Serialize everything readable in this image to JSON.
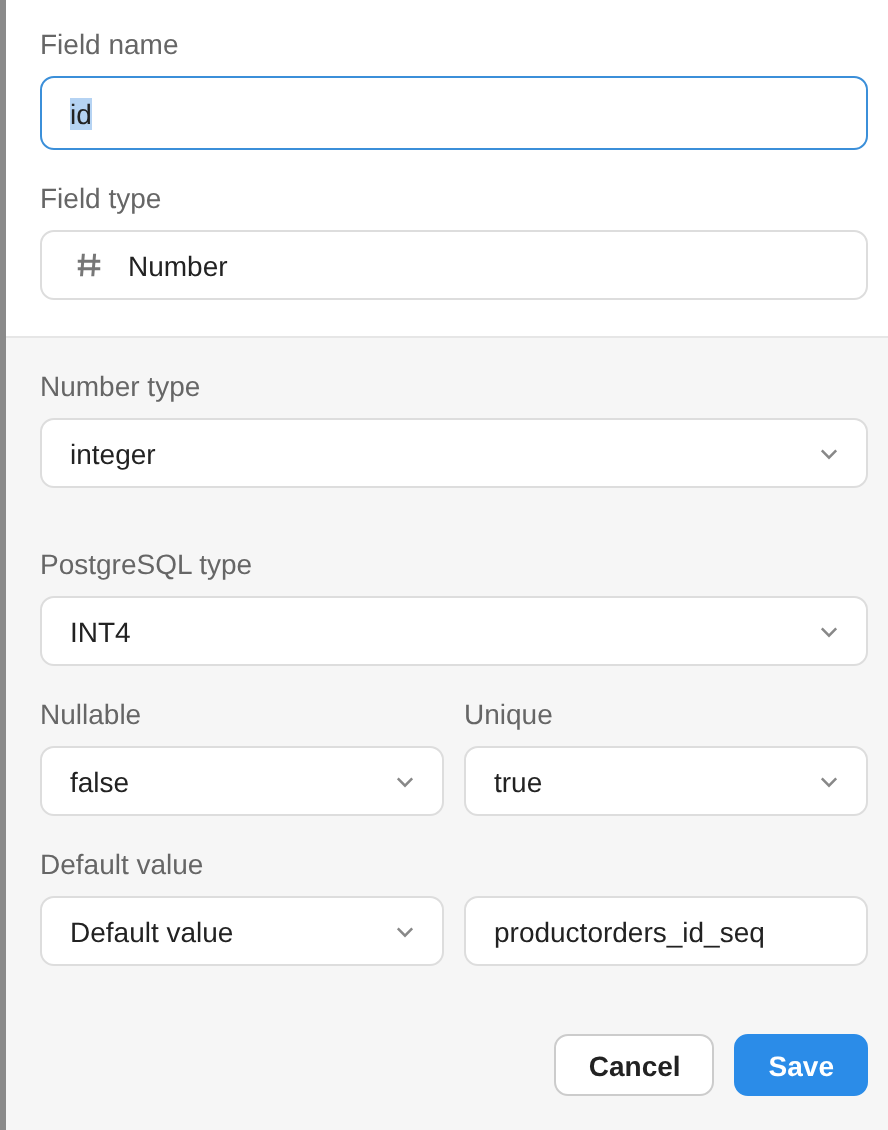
{
  "name_field": {
    "label": "Field name",
    "value": "id",
    "focused": true,
    "highlighted": true
  },
  "type_field": {
    "label": "Field type",
    "value": "Number"
  },
  "rows": [
    {
      "fields": [
        {
          "label": "Number type",
          "kind": "select",
          "value": "integer"
        }
      ]
    },
    {
      "fields": [
        {
          "label": "PostgreSQL type",
          "kind": "select",
          "value": "INT4"
        }
      ]
    },
    {
      "fields": [
        {
          "label": "Nullable",
          "kind": "select",
          "value": "false"
        },
        {
          "label": "Unique",
          "kind": "select",
          "value": "true"
        }
      ]
    },
    {
      "label": "Default value",
      "fields": [
        {
          "kind": "select",
          "value": "Default value"
        },
        {
          "kind": "input",
          "value": "productorders_id_seq"
        }
      ]
    }
  ],
  "buttons": [
    {
      "label": "Cancel",
      "kind": "secondary"
    },
    {
      "label": "Save",
      "kind": "primary"
    }
  ]
}
